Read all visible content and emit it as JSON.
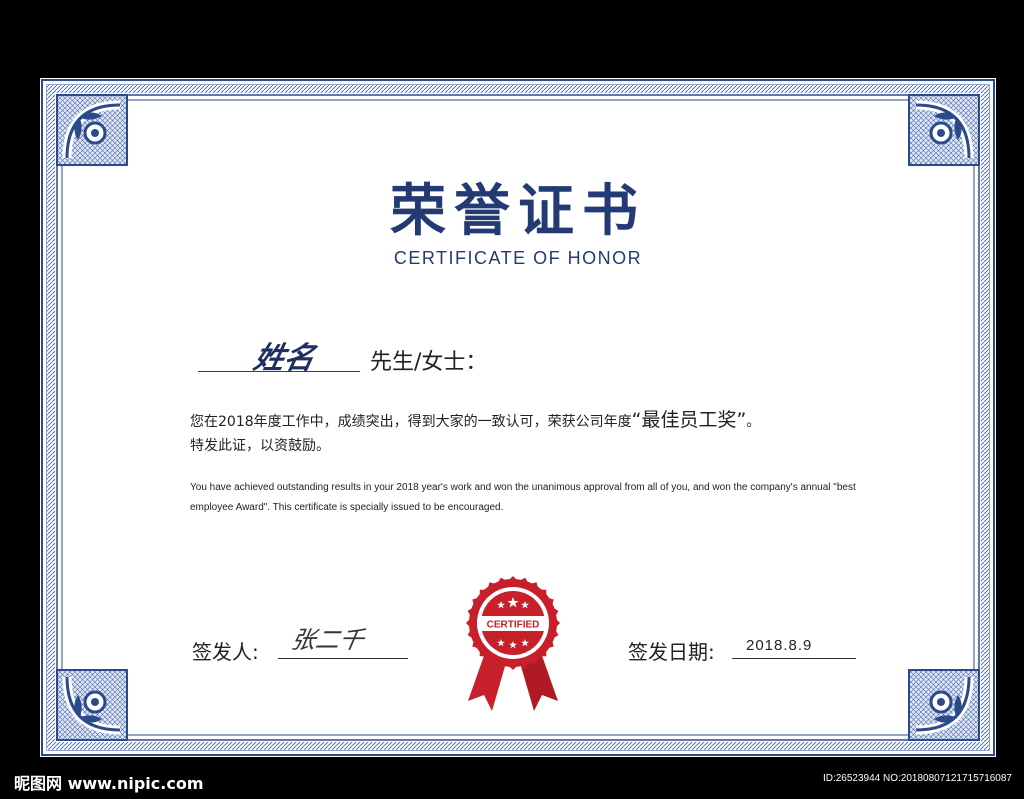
{
  "certificate": {
    "title_cn": "荣誉证书",
    "title_en": "CERTIFICATE OF HONOR",
    "recipient_name": "姓名",
    "salutation": "先生/女士：",
    "body_cn_prefix": "您在2018年度工作中，成绩突出，得到大家的一致认可，荣获公司年度",
    "award_name": "“最佳员工奖”",
    "body_cn_suffix": "。",
    "body_cn_line2": "特发此证，以资鼓励。",
    "body_en": "You have achieved outstanding results in your 2018 year's work and won the unanimous approval from all of you, and won the company's annual \"best employee Award\". This certificate is specially issued to be encouraged.",
    "issuer_label": "签发人:",
    "issuer_signature": "张二千",
    "date_label": "签发日期:",
    "date_value": "2018.8.9",
    "seal_text": "CERTIFIED"
  },
  "footer": {
    "logo_text": "昵图网 www.nipic.com",
    "image_id": "ID:26523944 NO:20180807121715716087"
  },
  "colors": {
    "frame_blue": "#2b4a8c",
    "title_navy": "#233a73",
    "seal_red": "#c8202a"
  }
}
